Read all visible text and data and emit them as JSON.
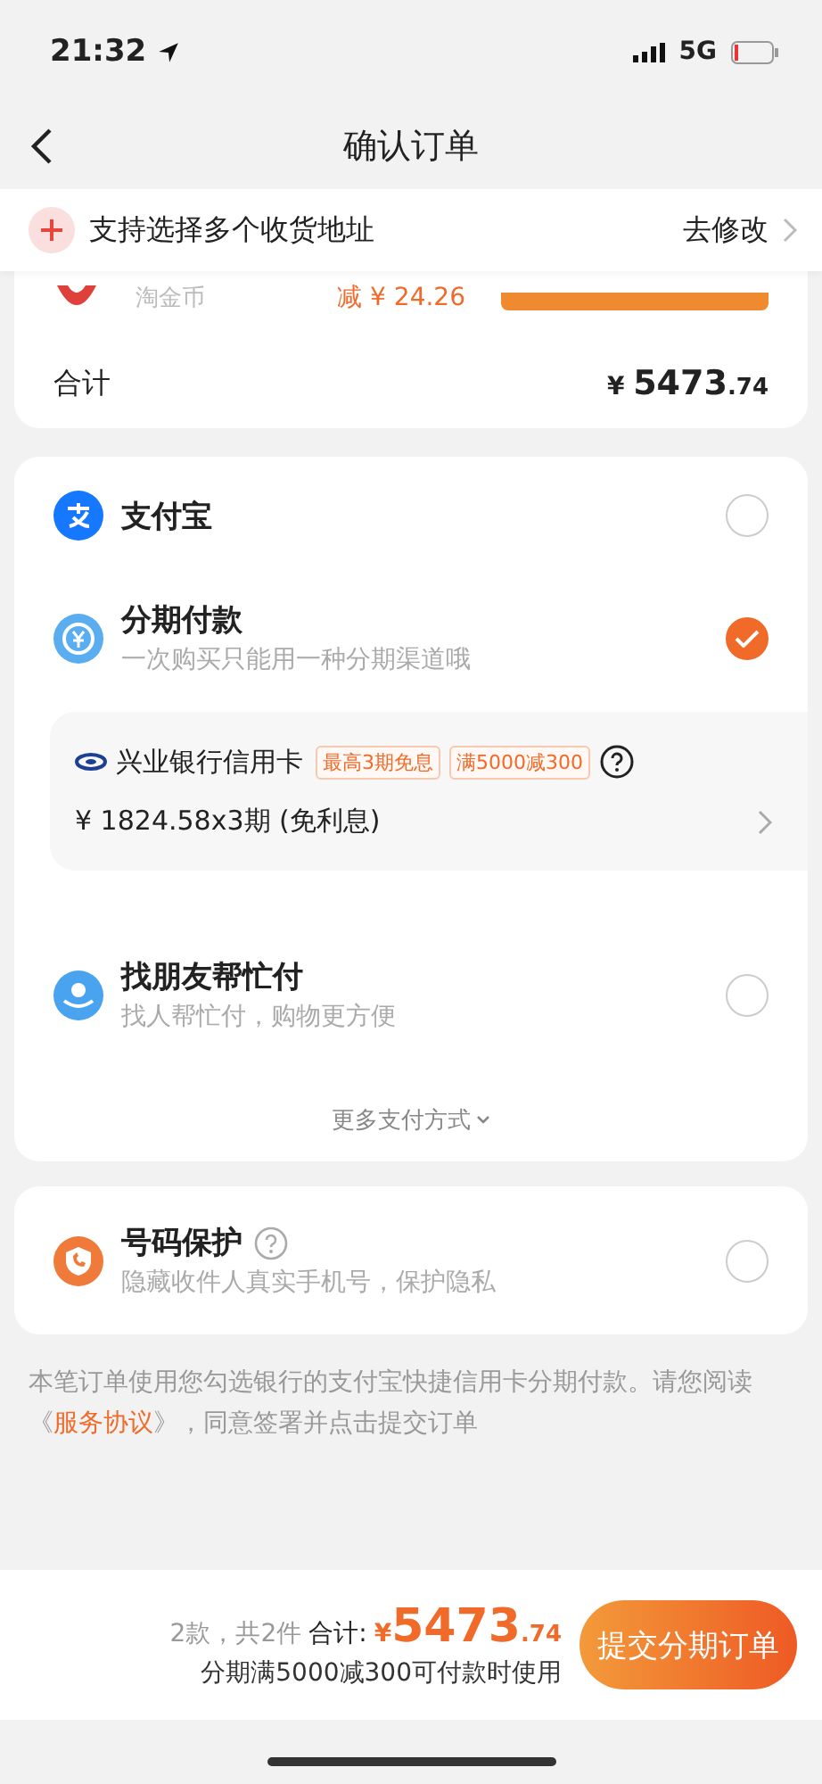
{
  "status_bar": {
    "time": "21:32",
    "network": "5G"
  },
  "nav": {
    "title": "确认订单"
  },
  "address_banner": {
    "text": "支持选择多个收货地址",
    "action": "去修改"
  },
  "order_card": {
    "partial_row": {
      "label": "淘金币",
      "discount": "减 ¥ 24.26"
    },
    "total_label": "合计",
    "total_currency": "¥",
    "total_int": "5473",
    "total_dec": ".74"
  },
  "payment_methods": [
    {
      "kind": "alipay",
      "title": "支付宝",
      "selected": false
    },
    {
      "kind": "installment",
      "title": "分期付款",
      "subtitle": "一次购买只能用一种分期渠道哦",
      "selected": true
    },
    {
      "kind": "friend",
      "title": "找朋友帮忙付",
      "subtitle": "找人帮忙付，购物更方便",
      "selected": false
    }
  ],
  "bank": {
    "name": "兴业银行信用卡",
    "tags": [
      "最高3期免息",
      "满5000减300"
    ],
    "plan": "¥ 1824.58x3期 (免利息)"
  },
  "more_methods": "更多支付方式",
  "number_protection": {
    "title": "号码保护",
    "subtitle": "隐藏收件人真实手机号，保护隐私",
    "selected": false
  },
  "notice": {
    "before": "本笔订单使用您勾选银行的支付宝快捷信用卡分期付款。请您阅读《",
    "link": "服务协议",
    "after": "》，同意签署并点击提交订单"
  },
  "bottom_bar": {
    "count": "2款，共2件",
    "total_label": "合计:",
    "currency": "¥",
    "total_int": "5473",
    "total_dec": ".74",
    "hint": "分期满5000减300可付款时使用",
    "submit": "提交分期订单"
  }
}
